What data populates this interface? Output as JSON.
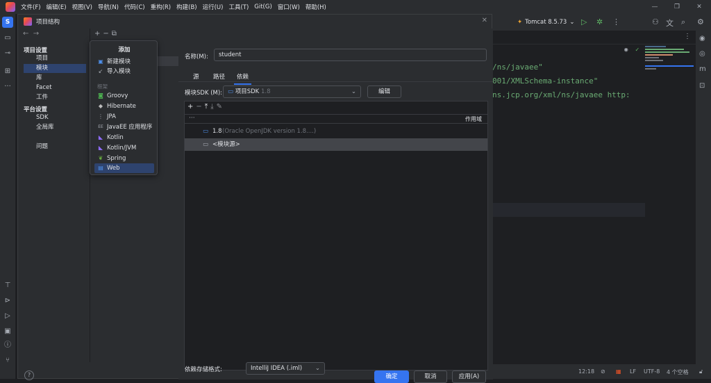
{
  "menubar": {
    "items": [
      "文件(F)",
      "编辑(E)",
      "视图(V)",
      "导航(N)",
      "代码(C)",
      "重构(R)",
      "构建(B)",
      "运行(U)",
      "工具(T)",
      "Git(G)",
      "窗口(W)",
      "帮助(H)"
    ]
  },
  "toolbar": {
    "run_config": "Tomcat 8.5.73"
  },
  "editor": {
    "lines": [
      "/ns/javaee\"",
      "001/XMLSchema-instance\"",
      "ns.jcp.org/xml/ns/javaee http:"
    ]
  },
  "statusbar": {
    "time": "12:18",
    "line_sep": "LF",
    "encoding": "UTF-8",
    "indent": "4 个空格"
  },
  "dialog": {
    "title": "项目结构",
    "nav": {
      "section_project": "项目设置",
      "items_project": [
        "项目",
        "模块",
        "库",
        "Facet",
        "工件"
      ],
      "section_platform": "平台设置",
      "items_platform": [
        "SDK",
        "全局库"
      ],
      "problems": "问题"
    },
    "popup": {
      "title": "添加",
      "actions": [
        {
          "label": "新建模块",
          "icon": "new-module-icon"
        },
        {
          "label": "导入模块",
          "icon": "import-module-icon"
        }
      ],
      "framework_section": "框架",
      "frameworks": [
        {
          "label": "Groovy",
          "icon": "groovy-icon",
          "color": "#4caf50"
        },
        {
          "label": "Hibernate",
          "icon": "hibernate-icon",
          "color": "#bcbcbc"
        },
        {
          "label": "JPA",
          "icon": "jpa-icon",
          "color": "#a8adb5"
        },
        {
          "label": "JavaEE 应用程序",
          "icon": "javaee-icon",
          "color": "#a8adb5"
        },
        {
          "label": "Kotlin",
          "icon": "kotlin-icon",
          "color": "#8f6cff"
        },
        {
          "label": "Kotlin/JVM",
          "icon": "kotlin-jvm-icon",
          "color": "#8f6cff"
        },
        {
          "label": "Spring",
          "icon": "spring-icon",
          "color": "#6db33f"
        },
        {
          "label": "Web",
          "icon": "web-icon",
          "color": "#4e8fea"
        }
      ]
    },
    "module": {
      "name_label": "名称(M):",
      "name_value": "student",
      "tabs": [
        "源",
        "路径",
        "依赖"
      ],
      "sdk_label": "模块SDK (M):",
      "sdk_value": "项目SDK",
      "sdk_version": "1.8",
      "edit_button": "编辑",
      "scope_header": "作用域",
      "header_dots": "···",
      "deps": [
        {
          "name": "1.8",
          "detail": "(Oracle OpenJDK version 1.8....)"
        },
        {
          "name": "<模块源>"
        }
      ],
      "storage_label": "依赖存储格式:",
      "storage_value": "IntelliJ IDEA (.iml)"
    },
    "buttons": {
      "ok": "确定",
      "cancel": "取消",
      "apply": "应用(A)"
    },
    "help": "?"
  }
}
